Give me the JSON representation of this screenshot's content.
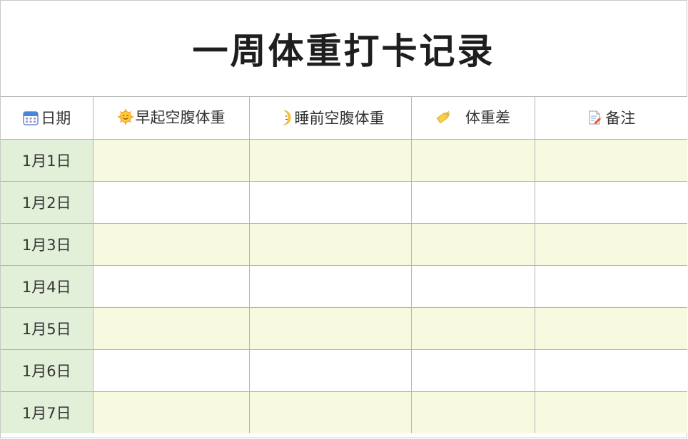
{
  "title": "一周体重打卡记录",
  "columns": [
    {
      "icon": "calendar-icon",
      "label": "日期"
    },
    {
      "icon": "smiling-sun-icon",
      "label": "早起空腹体重"
    },
    {
      "icon": "crescent-moon-icon",
      "label": "睡前空腹体重"
    },
    {
      "icon": "tag-icon",
      "label": "体重差"
    },
    {
      "icon": "memo-pencil-icon",
      "label": "备注"
    }
  ],
  "rows": [
    {
      "date": "1月1日",
      "morning": "",
      "night": "",
      "diff": "",
      "note": ""
    },
    {
      "date": "1月2日",
      "morning": "",
      "night": "",
      "diff": "",
      "note": ""
    },
    {
      "date": "1月3日",
      "morning": "",
      "night": "",
      "diff": "",
      "note": ""
    },
    {
      "date": "1月4日",
      "morning": "",
      "night": "",
      "diff": "",
      "note": ""
    },
    {
      "date": "1月5日",
      "morning": "",
      "night": "",
      "diff": "",
      "note": ""
    },
    {
      "date": "1月6日",
      "morning": "",
      "night": "",
      "diff": "",
      "note": ""
    },
    {
      "date": "1月7日",
      "morning": "",
      "night": "",
      "diff": "",
      "note": ""
    }
  ],
  "colors": {
    "date_column": "#e2efd9",
    "stripe": "#f7fadf",
    "grid": "#b4b4b4"
  }
}
